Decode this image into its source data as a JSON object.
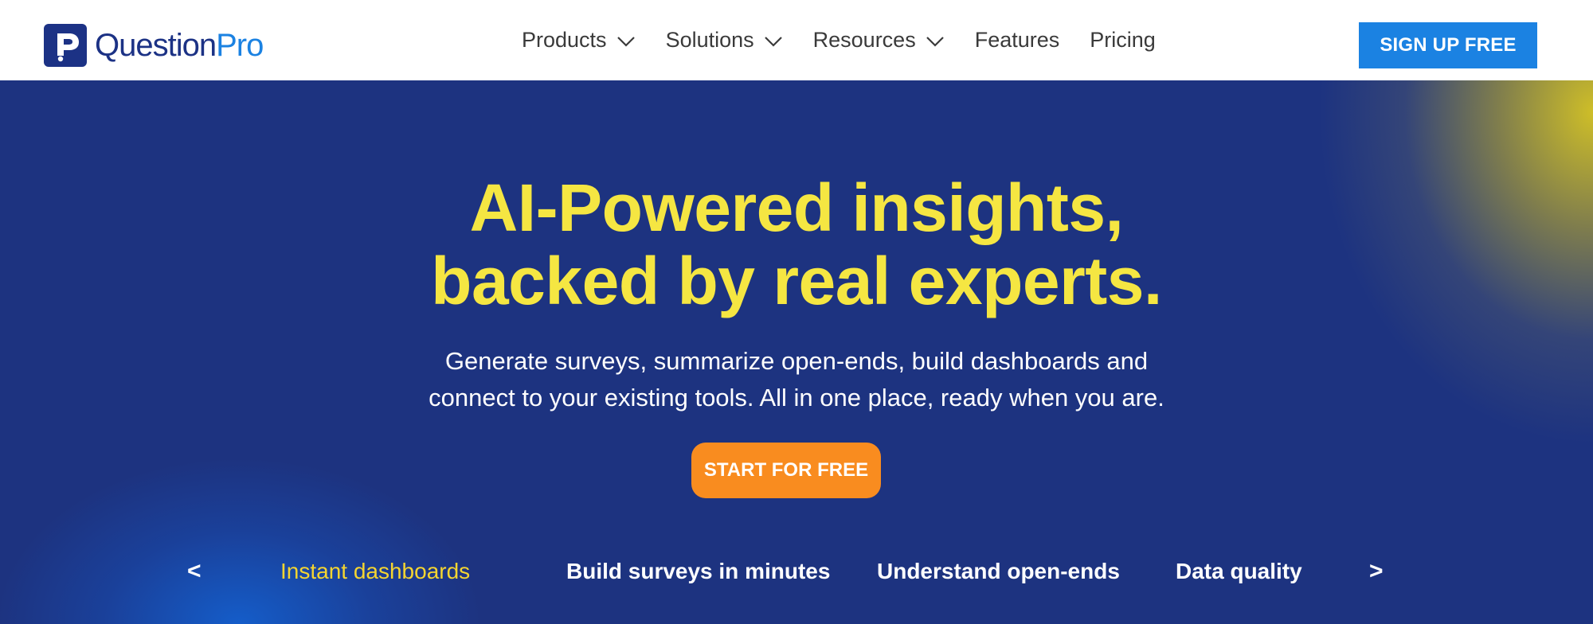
{
  "header": {
    "logo": {
      "part1": "Question",
      "part2": "Pro",
      "icon": "questionpro-logo-icon"
    },
    "nav": [
      {
        "label": "Products",
        "has_dropdown": true
      },
      {
        "label": "Solutions",
        "has_dropdown": true
      },
      {
        "label": "Resources",
        "has_dropdown": true
      },
      {
        "label": "Features",
        "has_dropdown": false
      },
      {
        "label": "Pricing",
        "has_dropdown": false
      }
    ],
    "signup_label": "SIGN UP FREE"
  },
  "hero": {
    "title_line1": "AI-Powered insights,",
    "title_line2": "backed by real experts.",
    "subtitle_line1": "Generate surveys, summarize open-ends, build dashboards and",
    "subtitle_line2": "connect to your existing tools. All in one place, ready when you are.",
    "cta_label": "START FOR FREE"
  },
  "carousel": {
    "prev": "<",
    "next": ">",
    "tabs": [
      {
        "label": "Instant dashboards",
        "active": true
      },
      {
        "label": "Build surveys in minutes",
        "active": false
      },
      {
        "label": "Understand open-ends",
        "active": false
      },
      {
        "label": "Data quality",
        "active": false
      }
    ]
  },
  "colors": {
    "brand_dark": "#1c3285",
    "brand_blue": "#1b82e2",
    "hero_bg": "#1d3380",
    "headline_yellow": "#f5e642",
    "cta_orange": "#f98c1f",
    "active_tab": "#f5d530"
  }
}
